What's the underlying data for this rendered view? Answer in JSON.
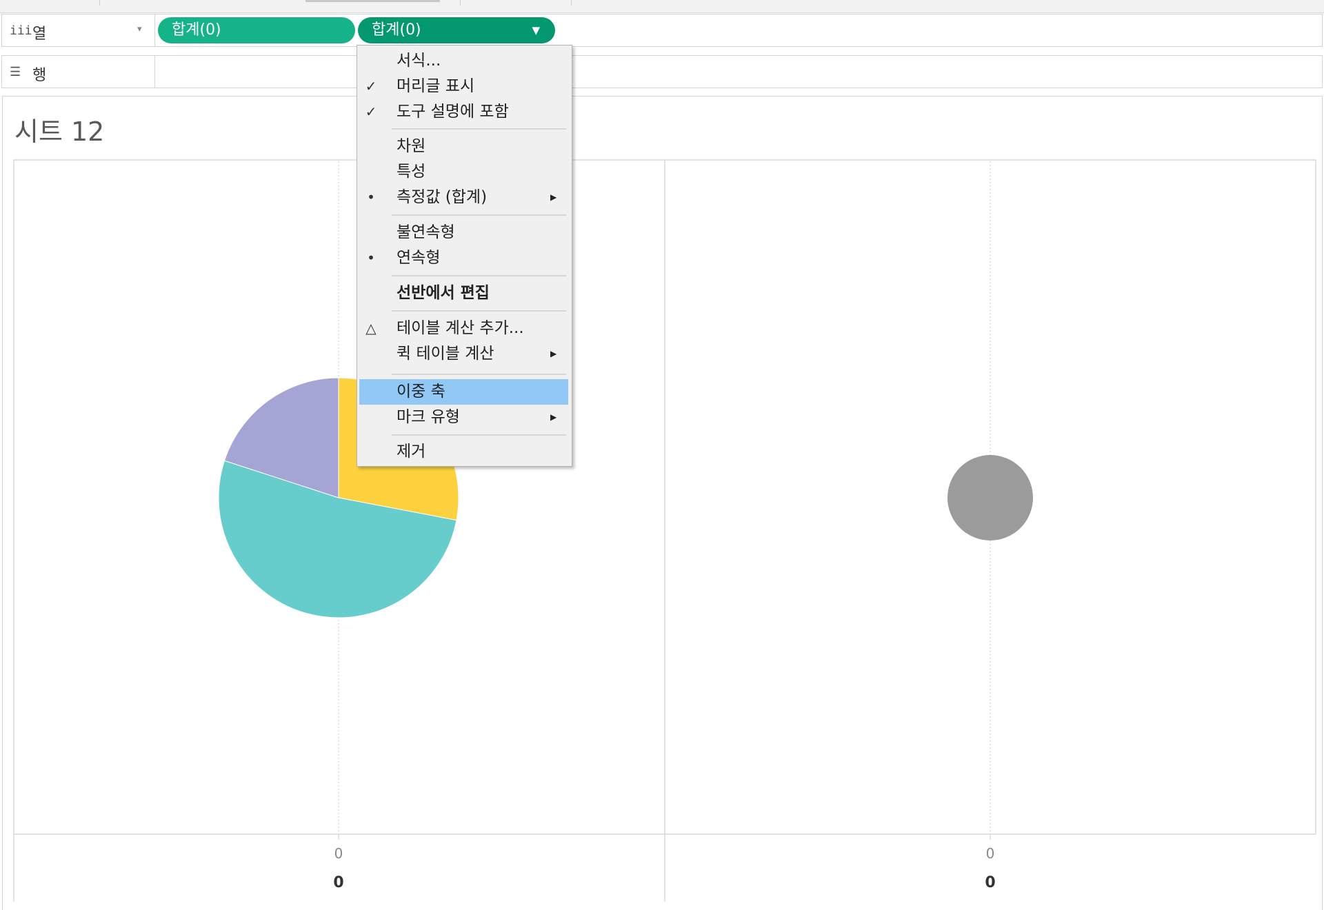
{
  "shelves": {
    "columns": {
      "label": "열",
      "icon": "iii",
      "arrow": "▾"
    },
    "rows": {
      "label": "행",
      "icon": "☰"
    }
  },
  "pills": [
    {
      "label": "합계(0)",
      "color": "#16b28a"
    },
    {
      "label": "합계(0)",
      "color": "#039870",
      "arrow": "▼"
    }
  ],
  "sheet": {
    "title": "시트 12"
  },
  "context_menu": {
    "items": [
      {
        "label": "서식...",
        "mark": "",
        "submenu": false,
        "bold": false,
        "highlight": false
      },
      {
        "label": "머리글 표시",
        "mark": "✓",
        "submenu": false,
        "bold": false,
        "highlight": false
      },
      {
        "label": "도구 설명에 포함",
        "mark": "✓",
        "submenu": false,
        "bold": false,
        "highlight": false
      },
      {
        "label": "차원",
        "mark": "",
        "submenu": false,
        "bold": false,
        "highlight": false
      },
      {
        "label": "특성",
        "mark": "",
        "submenu": false,
        "bold": false,
        "highlight": false
      },
      {
        "label": "측정값 (합계)",
        "mark": "•",
        "submenu": true,
        "bold": false,
        "highlight": false
      },
      {
        "label": "불연속형",
        "mark": "",
        "submenu": false,
        "bold": false,
        "highlight": false
      },
      {
        "label": "연속형",
        "mark": "•",
        "submenu": false,
        "bold": false,
        "highlight": false
      },
      {
        "label": "선반에서 편집",
        "mark": "",
        "submenu": false,
        "bold": true,
        "highlight": false
      },
      {
        "label": "테이블 계산 추가...",
        "mark": "△",
        "submenu": false,
        "bold": false,
        "highlight": false
      },
      {
        "label": "퀵 테이블 계산",
        "mark": "",
        "submenu": true,
        "bold": false,
        "highlight": false
      },
      {
        "label": "이중 축",
        "mark": "",
        "submenu": false,
        "bold": false,
        "highlight": true
      },
      {
        "label": "마크 유형",
        "mark": "",
        "submenu": true,
        "bold": false,
        "highlight": false
      },
      {
        "label": "제거",
        "mark": "",
        "submenu": false,
        "bold": false,
        "highlight": false
      }
    ],
    "highlight_color": "#91c8f5"
  },
  "chart_data": [
    {
      "type": "pie",
      "slices": [
        {
          "color": "#fcd13d",
          "value": 28
        },
        {
          "color": "#67cdcc",
          "value": 52
        },
        {
          "color": "#a4a5d4",
          "value": 20
        }
      ],
      "x_tick_labels": [
        "0"
      ],
      "x_axis_label": "0"
    },
    {
      "type": "scatter",
      "points": [
        {
          "x": 0,
          "y": 0,
          "color": "#9b9b9b"
        }
      ],
      "x_tick_labels": [
        "0"
      ],
      "x_axis_label": "0"
    }
  ]
}
